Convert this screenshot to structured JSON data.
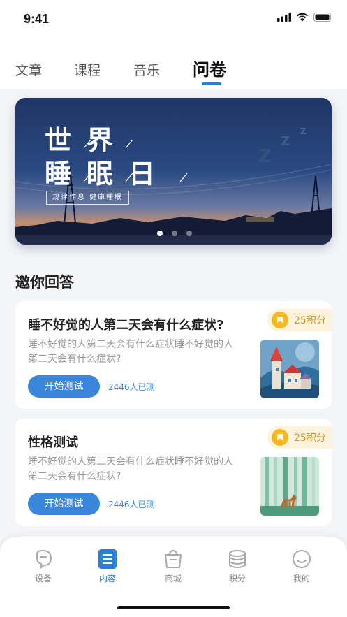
{
  "status_bar": {
    "time": "9:41"
  },
  "tabs": [
    {
      "label": "文章",
      "active": false
    },
    {
      "label": "课程",
      "active": false
    },
    {
      "label": "音乐",
      "active": false
    },
    {
      "label": "问卷",
      "active": true
    }
  ],
  "banner": {
    "title_line1": "世界",
    "title_line2": "睡眠日",
    "subtitle": "规律作息  健康睡眠",
    "slide_count": 3,
    "active_slide": 1
  },
  "section": {
    "title": "邀你回答"
  },
  "cards": [
    {
      "title": "睡不好觉的人第二天会有什么症状?",
      "description": "睡不好觉的人第二天会有什么症状睡不好觉的人第二天会有什么症状?",
      "points": "25积分",
      "button_label": "开始测试",
      "count_text": "2446人已测",
      "thumbnail_icon": "town-illustration"
    },
    {
      "title": "性格测试",
      "description": "睡不好觉的人第二天会有什么症状睡不好觉的人第二天会有什么症状?",
      "points": "25积分",
      "button_label": "开始测试",
      "count_text": "2446人已测",
      "thumbnail_icon": "forest-deer-illustration"
    }
  ],
  "bottom_nav": [
    {
      "label": "设备",
      "icon": "device-icon",
      "active": false
    },
    {
      "label": "内容",
      "icon": "content-icon",
      "active": true
    },
    {
      "label": "商城",
      "icon": "shop-icon",
      "active": false
    },
    {
      "label": "积分",
      "icon": "points-icon",
      "active": false
    },
    {
      "label": "我的",
      "icon": "profile-icon",
      "active": false
    }
  ],
  "colors": {
    "accent": "#2c7fd6",
    "button": "#3a86dc",
    "points_text": "#c99a2a",
    "points_bg": "#fdf3dd",
    "coin": "#f5b820"
  }
}
